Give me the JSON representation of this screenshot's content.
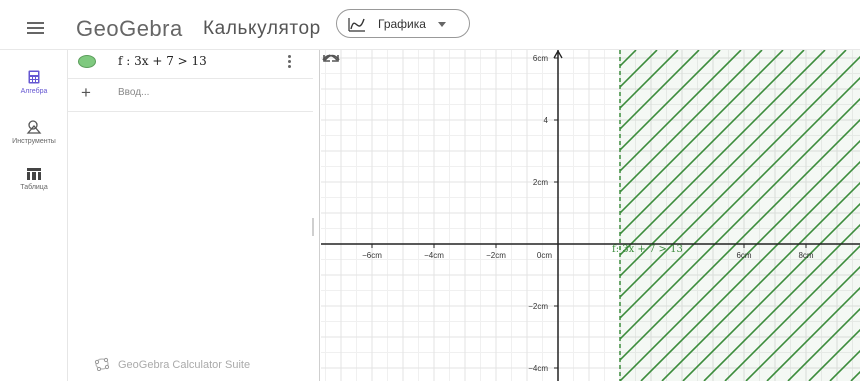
{
  "header": {
    "brand": "GeoGebra",
    "title": "Калькулятор",
    "mode": "Графика"
  },
  "rail": {
    "items": [
      {
        "label": "Алгебра",
        "icon": "calculator-icon"
      },
      {
        "label": "Инструменты",
        "icon": "tools-icon"
      },
      {
        "label": "Таблица",
        "icon": "table-icon"
      }
    ]
  },
  "algebra": {
    "expression": "f : 3x + 7 > 13",
    "input_placeholder": "Ввод...",
    "suite_label": "GeoGebra Calculator Suite"
  },
  "graph": {
    "function_label": "f: 3x + 7 > 13",
    "inequality": {
      "a": 3,
      "b": 7,
      "c": 13,
      "boundary_x": 2,
      "side": "right",
      "boundary_style": "dashed"
    },
    "x_ticks": [
      "−6cm",
      "−4cm",
      "−2cm",
      "0cm",
      "",
      "6cm",
      "8cm"
    ],
    "y_ticks": [
      "6cm",
      "4",
      "2cm",
      "−2cm",
      "−4cm"
    ],
    "colors": {
      "shade": "#3c8c3c",
      "grid": "#e3e3e3",
      "axis": "#222222"
    }
  }
}
